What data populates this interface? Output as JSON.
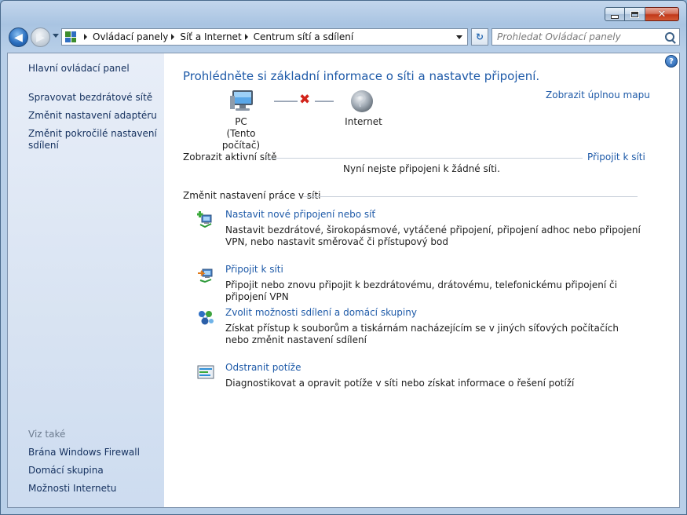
{
  "window": {
    "controls": {
      "minimize": "–",
      "maximize": "▢",
      "close": "✕"
    }
  },
  "nav": {
    "breadcrumb": [
      "Ovládací panely",
      "Síť a Internet",
      "Centrum sítí a sdílení"
    ],
    "search_placeholder": "Prohledat Ovládací panely"
  },
  "sidebar": {
    "home": "Hlavní ovládací panel",
    "links": [
      "Spravovat bezdrátové sítě",
      "Změnit nastavení adaptéru",
      "Změnit pokročilé nastavení sdílení"
    ],
    "see_also_title": "Viz také",
    "see_also": [
      "Brána Windows Firewall",
      "Domácí skupina",
      "Možnosti Internetu"
    ]
  },
  "main": {
    "help": "?",
    "title": "Prohlédněte si základní informace o síti a nastavte připojení.",
    "full_map": "Zobrazit úplnou mapu",
    "map": {
      "pc_name": "PC",
      "pc_sub": "(Tento počítač)",
      "internet": "Internet"
    },
    "active_networks": {
      "heading": "Zobrazit aktivní sítě",
      "connect": "Připojit k síti",
      "none": "Nyní nejste připojeni k žádné síti."
    },
    "change_settings_heading": "Změnit nastavení práce v síti",
    "tasks": [
      {
        "link": "Nastavit nové připojení nebo síť",
        "desc": "Nastavit bezdrátové, širokopásmové, vytáčené připojení, připojení adhoc nebo připojení VPN, nebo nastavit směrovač či přístupový bod",
        "icon": "new-connection-icon"
      },
      {
        "link": "Připojit k síti",
        "desc": "Připojit nebo znovu připojit k bezdrátovému, drátovému, telefonickému připojení či připojení VPN",
        "icon": "connect-network-icon"
      },
      {
        "link": "Zvolit možnosti sdílení a domácí skupiny",
        "desc": "Získat přístup k souborům a tiskárnám nacházejícím se v jiných síťových počítačích nebo změnit nastavení sdílení",
        "icon": "homegroup-icon"
      },
      {
        "link": "Odstranit potíže",
        "desc": "Diagnostikovat a opravit potíže v síti nebo získat informace o řešení potíží",
        "icon": "troubleshoot-icon"
      }
    ]
  }
}
